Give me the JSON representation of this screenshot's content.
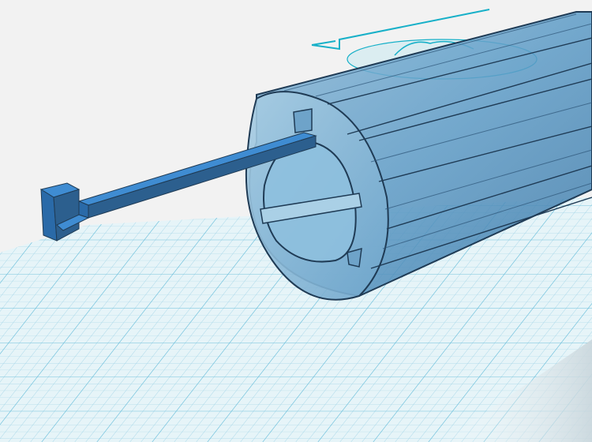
{
  "app": {
    "view": "3d-viewport"
  },
  "colors": {
    "background": "#f2f2f2",
    "grid_plane": "#e6f4f8",
    "grid_line": "#9fd3e6",
    "grid_major": "#62bcd9",
    "selection_accent": "#17b0c8",
    "tube": "#5d9bc6",
    "tube_edge": "#1f3b55",
    "rod": "#3f8cd2"
  },
  "scene": {
    "objects": [
      {
        "name": "tube",
        "selected": true
      },
      {
        "name": "hook-rod",
        "selected": true
      }
    ],
    "workplane": {
      "grid": true
    }
  }
}
